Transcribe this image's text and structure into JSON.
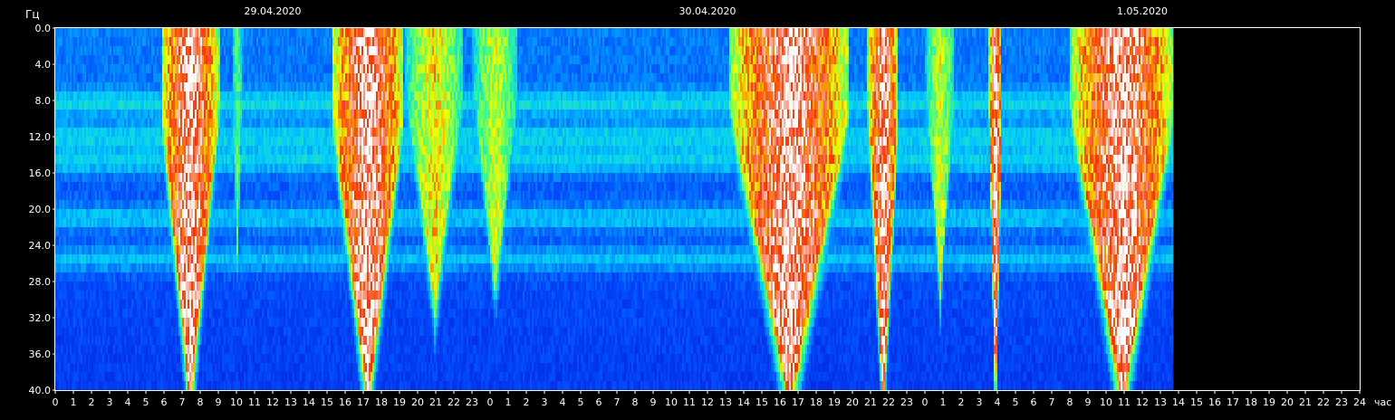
{
  "chart_data": {
    "type": "heatmap",
    "title": "",
    "ylabel": "Гц",
    "xlabel": "час",
    "ylim": [
      0,
      40
    ],
    "y_ticks": [
      "0.0",
      "4.0",
      "8.0",
      "12.0",
      "16.0",
      "20.0",
      "24.0",
      "28.0",
      "32.0",
      "36.0",
      "40.0"
    ],
    "dates": [
      {
        "label": "29.04.2020",
        "hour": 12
      },
      {
        "label": "30.04.2020",
        "hour": 36
      },
      {
        "label": "1.05.2020",
        "hour": 60
      }
    ],
    "x_tick_labels": [
      "0",
      "1",
      "2",
      "3",
      "4",
      "5",
      "6",
      "7",
      "8",
      "9",
      "10",
      "11",
      "12",
      "13",
      "14",
      "15",
      "16",
      "17",
      "18",
      "19",
      "20",
      "21",
      "22",
      "23",
      "0",
      "1",
      "2",
      "3",
      "4",
      "5",
      "6",
      "7",
      "8",
      "9",
      "10",
      "11",
      "12",
      "13",
      "14",
      "15",
      "16",
      "17",
      "18",
      "19",
      "20",
      "21",
      "22",
      "23",
      "0",
      "1",
      "2",
      "3",
      "4",
      "5",
      "6",
      "7",
      "8",
      "9",
      "10",
      "11",
      "12",
      "13",
      "14",
      "15",
      "16",
      "17",
      "18",
      "19",
      "20",
      "21",
      "22",
      "23",
      "24"
    ],
    "x_range_hours": [
      0,
      72
    ],
    "data_end_hour": 61.7,
    "color_scale": [
      "#000060",
      "#0010d0",
      "#0050ff",
      "#00c8ff",
      "#40ff80",
      "#f0ff00",
      "#ff3000",
      "#ffffff"
    ],
    "bursts": [
      {
        "start": 5.8,
        "end": 9.0,
        "peak": 1.0
      },
      {
        "start": 9.7,
        "end": 10.3,
        "peak": 0.6
      },
      {
        "start": 15.2,
        "end": 19.2,
        "peak": 1.0
      },
      {
        "start": 19.3,
        "end": 22.5,
        "peak": 0.75
      },
      {
        "start": 23.0,
        "end": 25.5,
        "peak": 0.7
      },
      {
        "start": 37.2,
        "end": 43.8,
        "peak": 1.0
      },
      {
        "start": 44.8,
        "end": 46.5,
        "peak": 1.0
      },
      {
        "start": 48.0,
        "end": 49.6,
        "peak": 0.7
      },
      {
        "start": 51.5,
        "end": 52.2,
        "peak": 1.0
      },
      {
        "start": 56.0,
        "end": 61.7,
        "peak": 1.0
      }
    ],
    "bands_hz": [
      7.8,
      11.5,
      14.2,
      20.5,
      25.0
    ],
    "grid": false
  }
}
